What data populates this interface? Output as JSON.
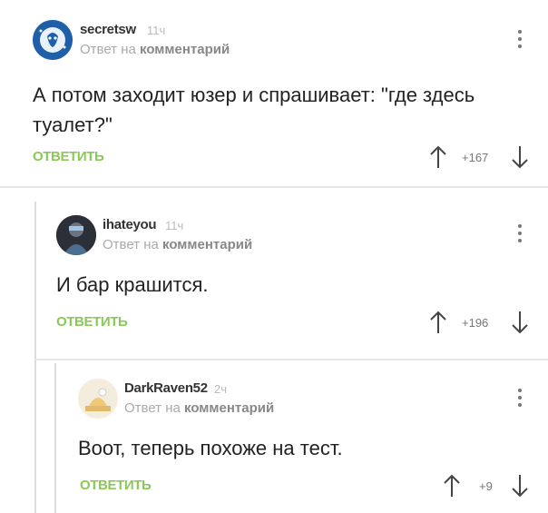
{
  "comments": [
    {
      "author": "secretsw",
      "time": "11ч",
      "reply_prefix": "Ответ на",
      "reply_link": "комментарий",
      "text": "А потом заходит юзер и спрашивает: \"где здесь туалет?\"",
      "reply_label": "ОТВЕТИТЬ",
      "rating": "+167"
    },
    {
      "author": "ihateyou",
      "time": "11ч",
      "reply_prefix": "Ответ на",
      "reply_link": "комментарий",
      "text": "И бар крашится.",
      "reply_label": "ОТВЕТИТЬ",
      "rating": "+196"
    },
    {
      "author": "DarkRaven52",
      "time": "2ч",
      "reply_prefix": "Ответ на",
      "reply_link": "комментарий",
      "text": "Воот, теперь похоже на тест.",
      "reply_label": "ОТВЕТИТЬ",
      "rating": "+9"
    }
  ],
  "icons": {
    "upvote": "arrow-up-icon",
    "downvote": "arrow-down-icon",
    "menu": "more-vertical-icon"
  },
  "colors": {
    "accent": "#8ac858",
    "text": "#222222",
    "muted": "#aaaaaa"
  }
}
